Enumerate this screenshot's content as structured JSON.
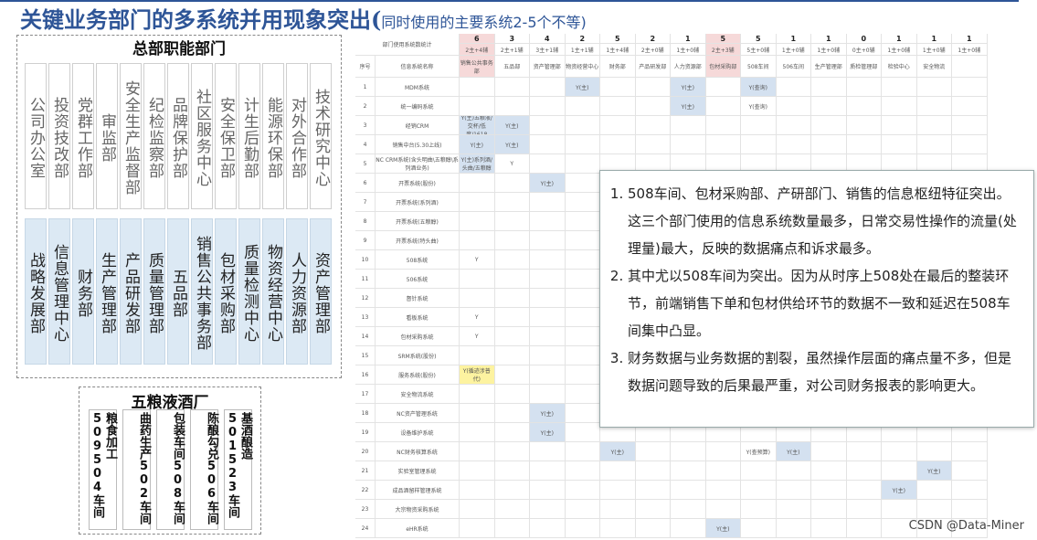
{
  "header": {
    "title_main": "关键业务部门的多系统并用现象突出(",
    "title_sub": "同时使用的主要系统2-5个不等)"
  },
  "hq": {
    "title": "总部职能部门",
    "top_row": [
      "公司办公室",
      "投资技改部",
      "党群工作部",
      "审监部",
      "安全生产监督部",
      "纪检监察部",
      "品牌保护部",
      "社区服务中心",
      "安全保卫部",
      "计生后勤部",
      "能源环保部",
      "对外合作部",
      "技术研究中心"
    ],
    "bottom_row": [
      "战略发展部",
      "信息管理中心",
      "财务部",
      "生产管理部",
      "产品研发部",
      "质量管理部",
      "五品部",
      "销售公共事务部",
      "包材采购部",
      "质量检测中心",
      "物资经营中心",
      "人力资源部",
      "资产管理部"
    ]
  },
  "plant": {
    "title": "五粮液酒厂",
    "units": [
      "粮食加工509504车间",
      "曲药生产502车间",
      "包装车间508车间",
      "陈酿勾兑506车间",
      "基酒酿造501523车间"
    ]
  },
  "table": {
    "stat_label": "部门使用系统数统计",
    "seq_label": "序号",
    "sys_label": "信息系统名称",
    "counts": [
      {
        "n": "6",
        "d": "2主+4辅"
      },
      {
        "n": "3",
        "d": "2主+1辅"
      },
      {
        "n": "4",
        "d": "3主+1辅"
      },
      {
        "n": "2",
        "d": "1主+1辅"
      },
      {
        "n": "5",
        "d": "1主+4辅"
      },
      {
        "n": "2",
        "d": "2主+0辅"
      },
      {
        "n": "1",
        "d": "1主+0辅"
      },
      {
        "n": "5",
        "d": "2主+3辅"
      },
      {
        "n": "5",
        "d": "5主+0辅"
      },
      {
        "n": "1",
        "d": "1主+0辅"
      },
      {
        "n": "1",
        "d": "1主+0辅"
      },
      {
        "n": "0",
        "d": "0主+0辅"
      },
      {
        "n": "1",
        "d": "1主+0辅"
      },
      {
        "n": "1",
        "d": "1主+0辅"
      },
      {
        "n": "1",
        "d": "1主+0辅"
      }
    ],
    "departments": [
      "销售公共事务部",
      "五品部",
      "资产管理部",
      "物资经营中心",
      "财务部",
      "产品研发部",
      "人力资源部",
      "包材采购部",
      "508车间",
      "506车间",
      "生产管理部",
      "质检管理部",
      "检验中心",
      "安全物流",
      ""
    ],
    "rows": [
      {
        "seq": "1",
        "name": "MDM系统"
      },
      {
        "seq": "2",
        "name": "统一编码系统"
      },
      {
        "seq": "3",
        "name": "经销CRM"
      },
      {
        "seq": "4",
        "name": "销售中台(5.30上线)"
      },
      {
        "seq": "5",
        "name": "NC CRM系统(含头明曲\\五粮醇\\系列酒业务)"
      },
      {
        "seq": "6",
        "name": "开票系统(股份)"
      },
      {
        "seq": "7",
        "name": "开票系统(系列酒)"
      },
      {
        "seq": "8",
        "name": "开票系统(五粮醇)"
      },
      {
        "seq": "9",
        "name": "开票系统(特头曲)"
      },
      {
        "seq": "10",
        "name": "508系统"
      },
      {
        "seq": "11",
        "name": "506系统"
      },
      {
        "seq": "12",
        "name": "督针系统"
      },
      {
        "seq": "13",
        "name": "看板系统"
      },
      {
        "seq": "14",
        "name": "包材采购系统"
      },
      {
        "seq": "15",
        "name": "SRM系统(股份)"
      },
      {
        "seq": "16",
        "name": "服务系统(股份)"
      },
      {
        "seq": "17",
        "name": "安全物流系统"
      },
      {
        "seq": "18",
        "name": "NC资产管理系统"
      },
      {
        "seq": "19",
        "name": "设备维护系统"
      },
      {
        "seq": "20",
        "name": "NC财务核算系统"
      },
      {
        "seq": "21",
        "name": "实验室管理系统"
      },
      {
        "seq": "22",
        "name": "成品酒留样管理系统"
      },
      {
        "seq": "23",
        "name": "大宗物资采购系统"
      },
      {
        "seq": "24",
        "name": "eHR系统"
      }
    ],
    "marks": {
      "y_main": "Y(主)",
      "y_query": "Y(查询)",
      "y_wuliang": "Y(主)五粮液/交杯/低度/1618",
      "y_series": "Y(主)系列酒/头曲/五粮醇",
      "y_cash": "Y(查预算)",
      "y_recycle": "Y(循迹涉普代)",
      "y": "Y"
    }
  },
  "callout": {
    "points": [
      "508车间、包材采购部、产研部门、销售的信息枢纽特征突出。这三个部门使用的信息系统数量最多，日常交易性操作的流量(处理量)最大，反映的数据痛点和诉求最多。",
      "其中尤以508车间为突出。因为从时序上508处在最后的整装环节，前端销售下单和包材供给环节的数据不一致和延迟在508车间集中凸显。",
      "财务数据与业务数据的割裂，虽然操作层面的痛点量不多，但是数据问题导致的后果最严重，对公司财务报表的影响更大。"
    ]
  },
  "watermark": "CSDN @Data-Miner"
}
